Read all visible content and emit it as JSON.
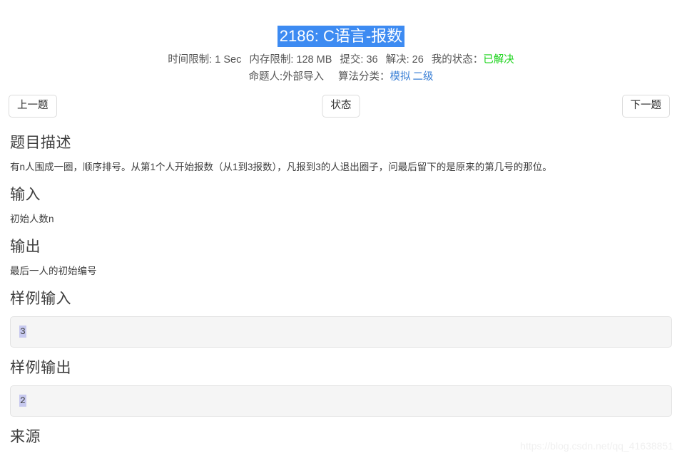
{
  "problem": {
    "title": "2186: C语言-报数",
    "limits": {
      "time_label": "时间限制:",
      "time_value": "1 Sec",
      "memory_label": "内存限制:",
      "memory_value": "128 MB",
      "submit_label": "提交:",
      "submit_value": "36",
      "solved_label": "解决:",
      "solved_value": "26",
      "my_status_label": "我的状态：",
      "my_status_value": "已解决"
    },
    "meta": {
      "author_label": "命题人:外部导入",
      "category_label": "算法分类：",
      "tags": [
        "模拟",
        "二级"
      ]
    }
  },
  "nav": {
    "prev_label": "上一题",
    "status_label": "状态",
    "next_label": "下一题"
  },
  "sections": {
    "description": {
      "title": "题目描述",
      "body": "有n人围成一圈，顺序排号。从第1个人开始报数（从1到3报数），凡报到3的人退出圈子，问最后留下的是原来的第几号的那位。"
    },
    "input": {
      "title": "输入",
      "body": "初始人数n"
    },
    "output": {
      "title": "输出",
      "body": "最后一人的初始编号"
    },
    "sample_input": {
      "title": "样例输入",
      "value": "3"
    },
    "sample_output": {
      "title": "样例输出",
      "value": "2"
    },
    "source": {
      "title": "来源"
    }
  },
  "watermark": {
    "text": "https://blog.csdn.net/qq_41638851"
  },
  "colors": {
    "title_selection_bg": "#3d8bf2",
    "solved_green": "#17d317",
    "link_blue": "#3a7fd5",
    "code_bg": "#f5f5f5",
    "code_selection": "#c7c9ef"
  }
}
